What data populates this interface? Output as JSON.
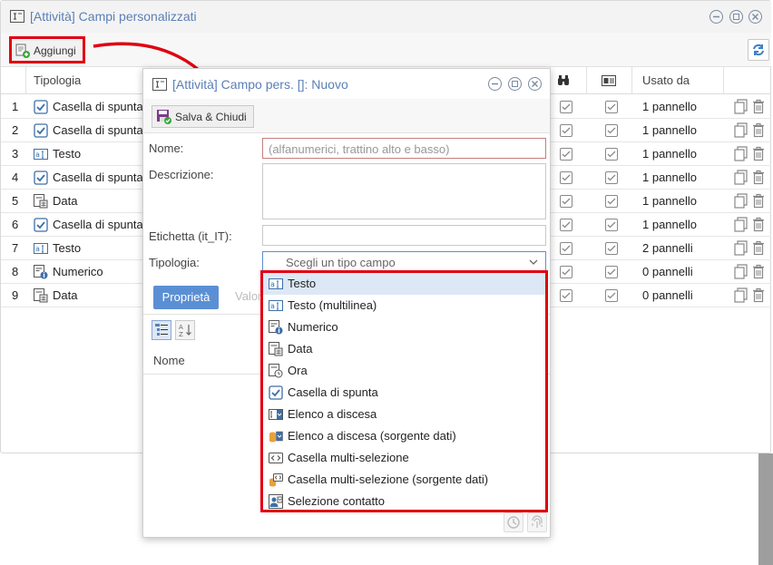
{
  "window": {
    "title": "[Attività] Campi personalizzati",
    "add_button_label": "Aggiungi"
  },
  "grid": {
    "headers": {
      "type": "Tipologia",
      "used": "Usato da"
    },
    "rows": [
      {
        "num": "1",
        "type": "Casella di spunta",
        "icon": "checkbox-icon",
        "used": "1 pannello"
      },
      {
        "num": "2",
        "type": "Casella di spunta",
        "icon": "checkbox-icon",
        "used": "1 pannello"
      },
      {
        "num": "3",
        "type": "Testo",
        "icon": "text-field-icon",
        "used": "1 pannello"
      },
      {
        "num": "4",
        "type": "Casella di spunta",
        "icon": "checkbox-icon",
        "used": "1 pannello"
      },
      {
        "num": "5",
        "type": "Data",
        "icon": "date-field-icon",
        "used": "1 pannello"
      },
      {
        "num": "6",
        "type": "Casella di spunta",
        "icon": "checkbox-icon",
        "used": "1 pannello"
      },
      {
        "num": "7",
        "type": "Testo",
        "icon": "text-field-icon",
        "used": "2 pannelli"
      },
      {
        "num": "8",
        "type": "Numerico",
        "icon": "numeric-field-icon",
        "used": "0 pannelli"
      },
      {
        "num": "9",
        "type": "Data",
        "icon": "date-field-icon",
        "used": "0 pannelli"
      }
    ]
  },
  "dialog": {
    "title": "[Attività] Campo pers. []: Nuovo",
    "save_label": "Salva & Chiudi",
    "fields": {
      "name_label": "Nome:",
      "name_placeholder": "(alfanumerici, trattino alto e basso)",
      "description_label": "Descrizione:",
      "tag_label": "Etichetta (it_IT):",
      "type_label": "Tipologia:",
      "type_placeholder": "Scegli un tipo campo"
    },
    "tabs": {
      "active": "Proprietà",
      "inactive": "Valori"
    },
    "properties_header": "Nome"
  },
  "dropdown": {
    "items": [
      {
        "label": "Testo",
        "icon": "text-field-icon",
        "highlighted": true
      },
      {
        "label": "Testo (multilinea)",
        "icon": "text-field-icon"
      },
      {
        "label": "Numerico",
        "icon": "numeric-field-icon"
      },
      {
        "label": "Data",
        "icon": "date-field-icon"
      },
      {
        "label": "Ora",
        "icon": "time-field-icon"
      },
      {
        "label": "Casella di spunta",
        "icon": "checkbox-icon"
      },
      {
        "label": "Elenco a discesa",
        "icon": "dropdown-list-icon"
      },
      {
        "label": "Elenco a discesa (sorgente dati)",
        "icon": "dropdown-datasource-icon"
      },
      {
        "label": "Casella multi-selezione",
        "icon": "multiselect-icon"
      },
      {
        "label": "Casella multi-selezione (sorgente dati)",
        "icon": "multiselect-datasource-icon"
      },
      {
        "label": "Selezione contatto",
        "icon": "contact-select-icon"
      }
    ]
  },
  "colors": {
    "accent": "#5b7fb5",
    "highlight_border": "#e00012",
    "tab_active": "#5b8fd4"
  }
}
